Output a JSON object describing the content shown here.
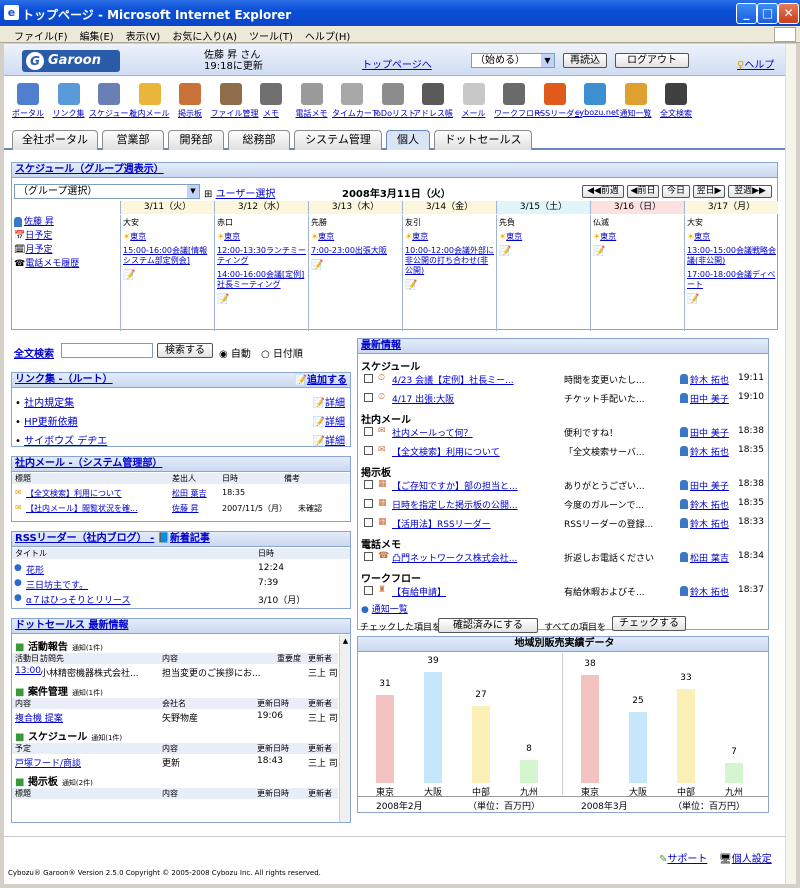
{
  "window": {
    "title": "トップページ - Microsoft Internet Explorer"
  },
  "menu": [
    "ファイル(F)",
    "編集(E)",
    "表示(V)",
    "お気に入り(A)",
    "ツール(T)",
    "ヘルプ(H)"
  ],
  "header": {
    "logo": "Garoon",
    "user_name": "佐藤 昇 さん",
    "updated": "19:18に更新",
    "top_link": "トップページへ",
    "start_select": "（始める）",
    "reload_btn": "再読込",
    "logout_btn": "ログアウト",
    "help": "ヘルプ"
  },
  "apps": [
    {
      "label": "ポータル",
      "color": "#4f7fce"
    },
    {
      "label": "リンク集",
      "color": "#5b9ad8"
    },
    {
      "label": "スケジュール",
      "color": "#6a7fb6"
    },
    {
      "label": "社内メール",
      "color": "#e9b53a"
    },
    {
      "label": "掲示板",
      "color": "#c9723a"
    },
    {
      "label": "ファイル管理",
      "color": "#8f6c4a"
    },
    {
      "label": "メモ",
      "color": "#707070"
    },
    {
      "label": "電話メモ",
      "color": "#9a9a9a"
    },
    {
      "label": "タイムカード",
      "color": "#a8a8a8"
    },
    {
      "label": "ToDoリスト",
      "color": "#8d8d8d"
    },
    {
      "label": "アドレス帳",
      "color": "#5a5a5a"
    },
    {
      "label": "メール",
      "color": "#c8c8c8"
    },
    {
      "label": "ワークフロー",
      "color": "#6a6a6a"
    },
    {
      "label": "RSSリーダー",
      "color": "#e05a1c"
    },
    {
      "label": "cybozu.net",
      "color": "#3c8fd0"
    },
    {
      "label": "通知一覧",
      "color": "#e0a030"
    },
    {
      "label": "全文検索",
      "color": "#404040"
    }
  ],
  "tabs": [
    "全社ポータル",
    "営業部",
    "開発部",
    "総務部",
    "システム管理",
    "個人",
    "ドットセールス"
  ],
  "schedule": {
    "title": "スケジュール（グループ週表示）",
    "group_select": "（グループ選択）",
    "user_select": "ユーザー選択",
    "date": "2008年3月11日（火）",
    "nav": [
      "◀◀前週",
      "◀前日",
      "今日",
      "翌日▶",
      "翌週▶▶"
    ],
    "days": [
      {
        "date": "3/11（火）",
        "rokuyo": "大安",
        "weather": "東京",
        "events": [
          "15:00-16:00会議[情報システム部定例会]"
        ]
      },
      {
        "date": "3/12（水）",
        "rokuyo": "赤口",
        "weather": "東京",
        "events": [
          "12:00-13:30ランチミーティング",
          "14:00-16:00会議[定例]社長ミーティング"
        ]
      },
      {
        "date": "3/13（木）",
        "rokuyo": "先勝",
        "weather": "東京",
        "events": [
          "7:00-23:00出張大阪"
        ]
      },
      {
        "date": "3/14（金）",
        "rokuyo": "友引",
        "weather": "東京",
        "events": [
          "10:00-12:00会議外部に非公開の打ち合わせ(非公開)"
        ]
      },
      {
        "date": "3/15（土）",
        "rokuyo": "先負",
        "weather": "東京",
        "events": []
      },
      {
        "date": "3/16（日）",
        "rokuyo": "仏滅",
        "weather": "東京",
        "events": []
      },
      {
        "date": "3/17（月）",
        "rokuyo": "大安",
        "weather": "東京",
        "events": [
          "13:00-15:00会議戦略会議(非公開)",
          "17:00-18:00会議ディベート"
        ]
      }
    ],
    "user": {
      "name": "佐藤 昇",
      "links": [
        "日予定",
        "月予定",
        "電話メモ履歴"
      ]
    }
  },
  "search": {
    "title": "全文検索",
    "button": "検索する",
    "opt_auto": "自動",
    "opt_date": "日付順"
  },
  "links": {
    "title": "リンク集 -（ルート）",
    "add": "追加する",
    "items": [
      "社内規定集",
      "HP更新依頼",
      "サイボウズ デヂエ"
    ],
    "detail": "詳細"
  },
  "mail": {
    "title": "社内メール -（システム管理部）",
    "headers": [
      "標題",
      "差出人",
      "日時",
      "備考"
    ],
    "rows": [
      [
        "【全文検索】利用について",
        "松田 葉吉",
        "18:35",
        ""
      ],
      [
        "【社内メール】閲覧状況を確...",
        "佐藤 昇",
        "2007/11/5（月）",
        "未確認"
      ]
    ]
  },
  "rss": {
    "title": "RSSリーダー（社内ブログ） -",
    "new": "新着記事",
    "headers": [
      "タイトル",
      "日時"
    ],
    "rows": [
      [
        "花形",
        "12:24"
      ],
      [
        "三日坊主です。",
        "7:39"
      ],
      [
        "α７はひっそりとリリース",
        "3/10（月）"
      ]
    ]
  },
  "dot": {
    "title": "ドットセールス 最新情報",
    "sec1": {
      "name": "活動報告",
      "count": "通知(1件)",
      "headers": [
        "活動日",
        "訪問先",
        "内容",
        "重要度",
        "更新者"
      ],
      "row": [
        "13:00",
        "小林精密機器株式会社...",
        "担当変更のご挨拶にお...",
        "",
        "三上 司"
      ]
    },
    "sec2": {
      "name": "案件管理",
      "count": "通知(1件)",
      "headers": [
        "内容",
        "会社名",
        "更新日時",
        "更新者"
      ],
      "row": [
        "複合機 提案",
        "矢野物産",
        "19:06",
        "三上 司"
      ]
    },
    "sec3": {
      "name": "スケジュール",
      "count": "通知(1件)",
      "headers": [
        "予定",
        "内容",
        "更新日時",
        "更新者"
      ],
      "row": [
        "戸塚フード/商談",
        "更新",
        "18:43",
        "三上 司"
      ]
    },
    "sec4": {
      "name": "掲示板",
      "count": "通知(2件)",
      "headers": [
        "標題",
        "内容",
        "更新日時",
        "更新者"
      ]
    }
  },
  "news": {
    "title": "最新情報",
    "cats": [
      "スケジュール",
      "社内メール",
      "掲示板",
      "電話メモ",
      "ワークフロー"
    ],
    "schedule": [
      [
        "4/23 会議【定例】社長ミー...",
        "時間を変更いたし...",
        "鈴木 拓也",
        "19:11"
      ],
      [
        "4/17 出張:大阪",
        "チケット手配いた...",
        "田中 美子",
        "19:10"
      ]
    ],
    "mail": [
      [
        "社内メールって何？",
        "便利ですね！",
        "田中 美子",
        "18:38"
      ],
      [
        "【全文検索】利用について",
        "「全文検索サーバ...",
        "鈴木 拓也",
        "18:35"
      ]
    ],
    "board": [
      [
        "【ご存知ですか】部の担当と...",
        "ありがとうござい...",
        "田中 美子",
        "18:38"
      ],
      [
        "日時を指定した掲示板の公開...",
        "今度のガルーンで...",
        "鈴木 拓也",
        "18:35"
      ],
      [
        "【活用法】RSSリーダー",
        "RSSリーダーの登録...",
        "鈴木 拓也",
        "18:33"
      ]
    ],
    "phone": [
      [
        "凸門ネットワークス株式会社...",
        "折返しお電話ください",
        "松田 葉吉",
        "18:34"
      ]
    ],
    "workflow": [
      [
        "【有給申請】",
        "有給休暇およびそ...",
        "鈴木 拓也",
        "18:37"
      ]
    ],
    "notice_list": "通知一覧",
    "checked_label": "チェックした項目を",
    "confirm_btn": "確認済みにする",
    "all_label": "すべての項目を",
    "check_btn": "チェックする"
  },
  "chart_data": [
    {
      "type": "bar",
      "title": "地域別販売実績データ",
      "categories": [
        "東京",
        "大阪",
        "中部",
        "九州"
      ],
      "values": [
        31,
        39,
        27,
        8
      ],
      "xlabel": "2008年2月",
      "ylabel": "（単位：百万円）",
      "colors": [
        "#f5c2c2",
        "#c6e6fb",
        "#fbf1b8",
        "#d4f5d0"
      ]
    },
    {
      "type": "bar",
      "categories": [
        "東京",
        "大阪",
        "中部",
        "九州"
      ],
      "values": [
        38,
        25,
        33,
        7
      ],
      "xlabel": "2008年3月",
      "ylabel": "（単位：百万円）",
      "colors": [
        "#f5c2c2",
        "#c6e6fb",
        "#fbf1b8",
        "#d4f5d0"
      ]
    }
  ],
  "footer": {
    "support": "サポート",
    "settings": "個人設定",
    "copyright": "Cybozu® Garoon® Version 2.5.0    Copyright © 2005-2008 Cybozu Inc. All rights reserved."
  }
}
